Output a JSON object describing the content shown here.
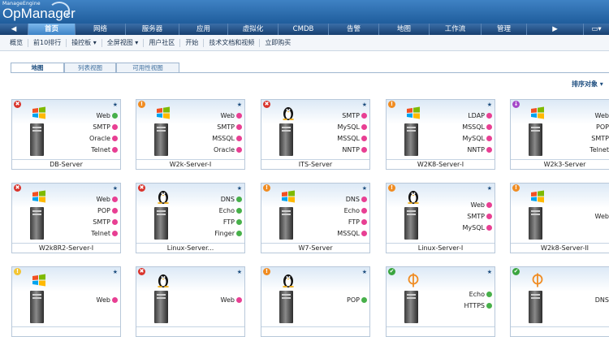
{
  "header": {
    "brand_small": "ManageEngine",
    "brand": "OpManager"
  },
  "nav": {
    "items": [
      "首页",
      "网络",
      "服务器",
      "应用",
      "虚拟化",
      "CMDB",
      "告警",
      "地图",
      "工作流",
      "管理"
    ],
    "active": "首页"
  },
  "subnav": {
    "items": [
      "概览",
      "前10排行",
      "操控板 ▾",
      "全屏视图 ▾",
      "用户社区",
      "开始",
      "技术文档和视频",
      "立即购买"
    ]
  },
  "tabs": [
    "地图",
    "列表视图",
    "可用性视图"
  ],
  "active_tab": "地图",
  "sort_label": "排序对象 ▾",
  "colors": {
    "critical": "#d9342c",
    "trouble": "#f08c22",
    "attention": "#f3c533",
    "clear": "#3aa53f",
    "service": "#a548c9",
    "up": "#47b04a",
    "down": "#e83f93"
  },
  "devices": [
    {
      "name": "DB-Server",
      "status": "critical",
      "os": "windows",
      "services": [
        {
          "label": "Web",
          "state": "up"
        },
        {
          "label": "SMTP",
          "state": "down"
        },
        {
          "label": "Oracle",
          "state": "down"
        },
        {
          "label": "Telnet",
          "state": "down"
        }
      ]
    },
    {
      "name": "W2k-Server-I",
      "status": "trouble",
      "os": "windows",
      "services": [
        {
          "label": "Web",
          "state": "down"
        },
        {
          "label": "SMTP",
          "state": "down"
        },
        {
          "label": "MSSQL",
          "state": "down"
        },
        {
          "label": "Oracle",
          "state": "down"
        }
      ]
    },
    {
      "name": "ITS-Server",
      "status": "critical",
      "os": "linux",
      "services": [
        {
          "label": "SMTP",
          "state": "down"
        },
        {
          "label": "MySQL",
          "state": "down"
        },
        {
          "label": "MSSQL",
          "state": "down"
        },
        {
          "label": "NNTP",
          "state": "down"
        }
      ]
    },
    {
      "name": "W2K8-Server-I",
      "status": "trouble",
      "os": "windows",
      "services": [
        {
          "label": "LDAP",
          "state": "down"
        },
        {
          "label": "MSSQL",
          "state": "down"
        },
        {
          "label": "MySQL",
          "state": "down"
        },
        {
          "label": "NNTP",
          "state": "down"
        }
      ]
    },
    {
      "name": "W2k3-Server",
      "status": "service",
      "os": "windows",
      "services": [
        {
          "label": "Web",
          "state": "up"
        },
        {
          "label": "POP",
          "state": "down"
        },
        {
          "label": "SMTP",
          "state": "down"
        },
        {
          "label": "Telnet",
          "state": "down"
        }
      ]
    },
    {
      "name": "W2k8R2-Server-I",
      "status": "critical",
      "os": "windows",
      "services": [
        {
          "label": "Web",
          "state": "down"
        },
        {
          "label": "POP",
          "state": "down"
        },
        {
          "label": "SMTP",
          "state": "down"
        },
        {
          "label": "Telnet",
          "state": "down"
        }
      ]
    },
    {
      "name": "Linux-Server...",
      "status": "critical",
      "os": "linux",
      "services": [
        {
          "label": "DNS",
          "state": "up"
        },
        {
          "label": "Echo",
          "state": "up"
        },
        {
          "label": "FTP",
          "state": "up"
        },
        {
          "label": "Finger",
          "state": "up"
        }
      ]
    },
    {
      "name": "W7-Server",
      "status": "trouble",
      "os": "windows",
      "services": [
        {
          "label": "DNS",
          "state": "down"
        },
        {
          "label": "Echo",
          "state": "down"
        },
        {
          "label": "FTP",
          "state": "down"
        },
        {
          "label": "MSSQL",
          "state": "down"
        }
      ]
    },
    {
      "name": "Linux-Server-I",
      "status": "trouble",
      "os": "linux",
      "services": [
        {
          "label": "Web",
          "state": "down"
        },
        {
          "label": "SMTP",
          "state": "down"
        },
        {
          "label": "MySQL",
          "state": "down"
        }
      ]
    },
    {
      "name": "W2k8-Server-II",
      "status": "trouble",
      "os": "windows",
      "services": [
        {
          "label": "Web",
          "state": "down"
        }
      ]
    },
    {
      "name": "",
      "status": "attention",
      "os": "windows",
      "services": [
        {
          "label": "Web",
          "state": "down"
        }
      ]
    },
    {
      "name": "",
      "status": "critical",
      "os": "linux",
      "services": [
        {
          "label": "Web",
          "state": "down"
        }
      ]
    },
    {
      "name": "",
      "status": "trouble",
      "os": "linux",
      "services": [
        {
          "label": "POP",
          "state": "up"
        }
      ]
    },
    {
      "name": "",
      "status": "clear",
      "os": "phi",
      "services": [
        {
          "label": "Echo",
          "state": "up"
        },
        {
          "label": "HTTPS",
          "state": "up"
        }
      ]
    },
    {
      "name": "",
      "status": "clear",
      "os": "phi",
      "services": [
        {
          "label": "DNS",
          "state": "up"
        }
      ]
    }
  ]
}
